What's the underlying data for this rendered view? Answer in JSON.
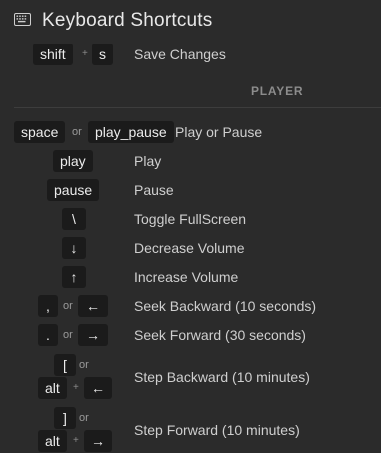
{
  "window": {
    "title": "Keyboard Shortcuts",
    "icon": "keyboard-icon"
  },
  "partial_row": {
    "keys": [
      "shift",
      "s"
    ],
    "joiner": "+",
    "description": "Save Changes"
  },
  "section": {
    "label": "PLAYER"
  },
  "rows": [
    {
      "keys": [
        "space",
        "play_pause"
      ],
      "joiner": "or",
      "description": "Play or Pause"
    },
    {
      "keys": [
        "play"
      ],
      "description": "Play"
    },
    {
      "keys": [
        "pause"
      ],
      "description": "Pause"
    },
    {
      "keys": [
        "\\"
      ],
      "description": "Toggle FullScreen"
    },
    {
      "keys": [
        "↓"
      ],
      "description": "Decrease Volume"
    },
    {
      "keys": [
        "↑"
      ],
      "description": "Increase Volume"
    },
    {
      "keys": [
        ",",
        "←"
      ],
      "joiner": "or",
      "description": "Seek Backward (10 seconds)"
    },
    {
      "keys": [
        ".",
        "→"
      ],
      "joiner": "or",
      "description": "Seek Forward (30 seconds)"
    },
    {
      "keys": [
        "[",
        "alt",
        "←"
      ],
      "joiner": "or",
      "joiner2": "+",
      "description": "Step Backward (10 minutes)"
    },
    {
      "keys": [
        "]",
        "alt",
        "→"
      ],
      "joiner": "or",
      "joiner2": "+",
      "description": "Step Forward (10 minutes)"
    }
  ]
}
